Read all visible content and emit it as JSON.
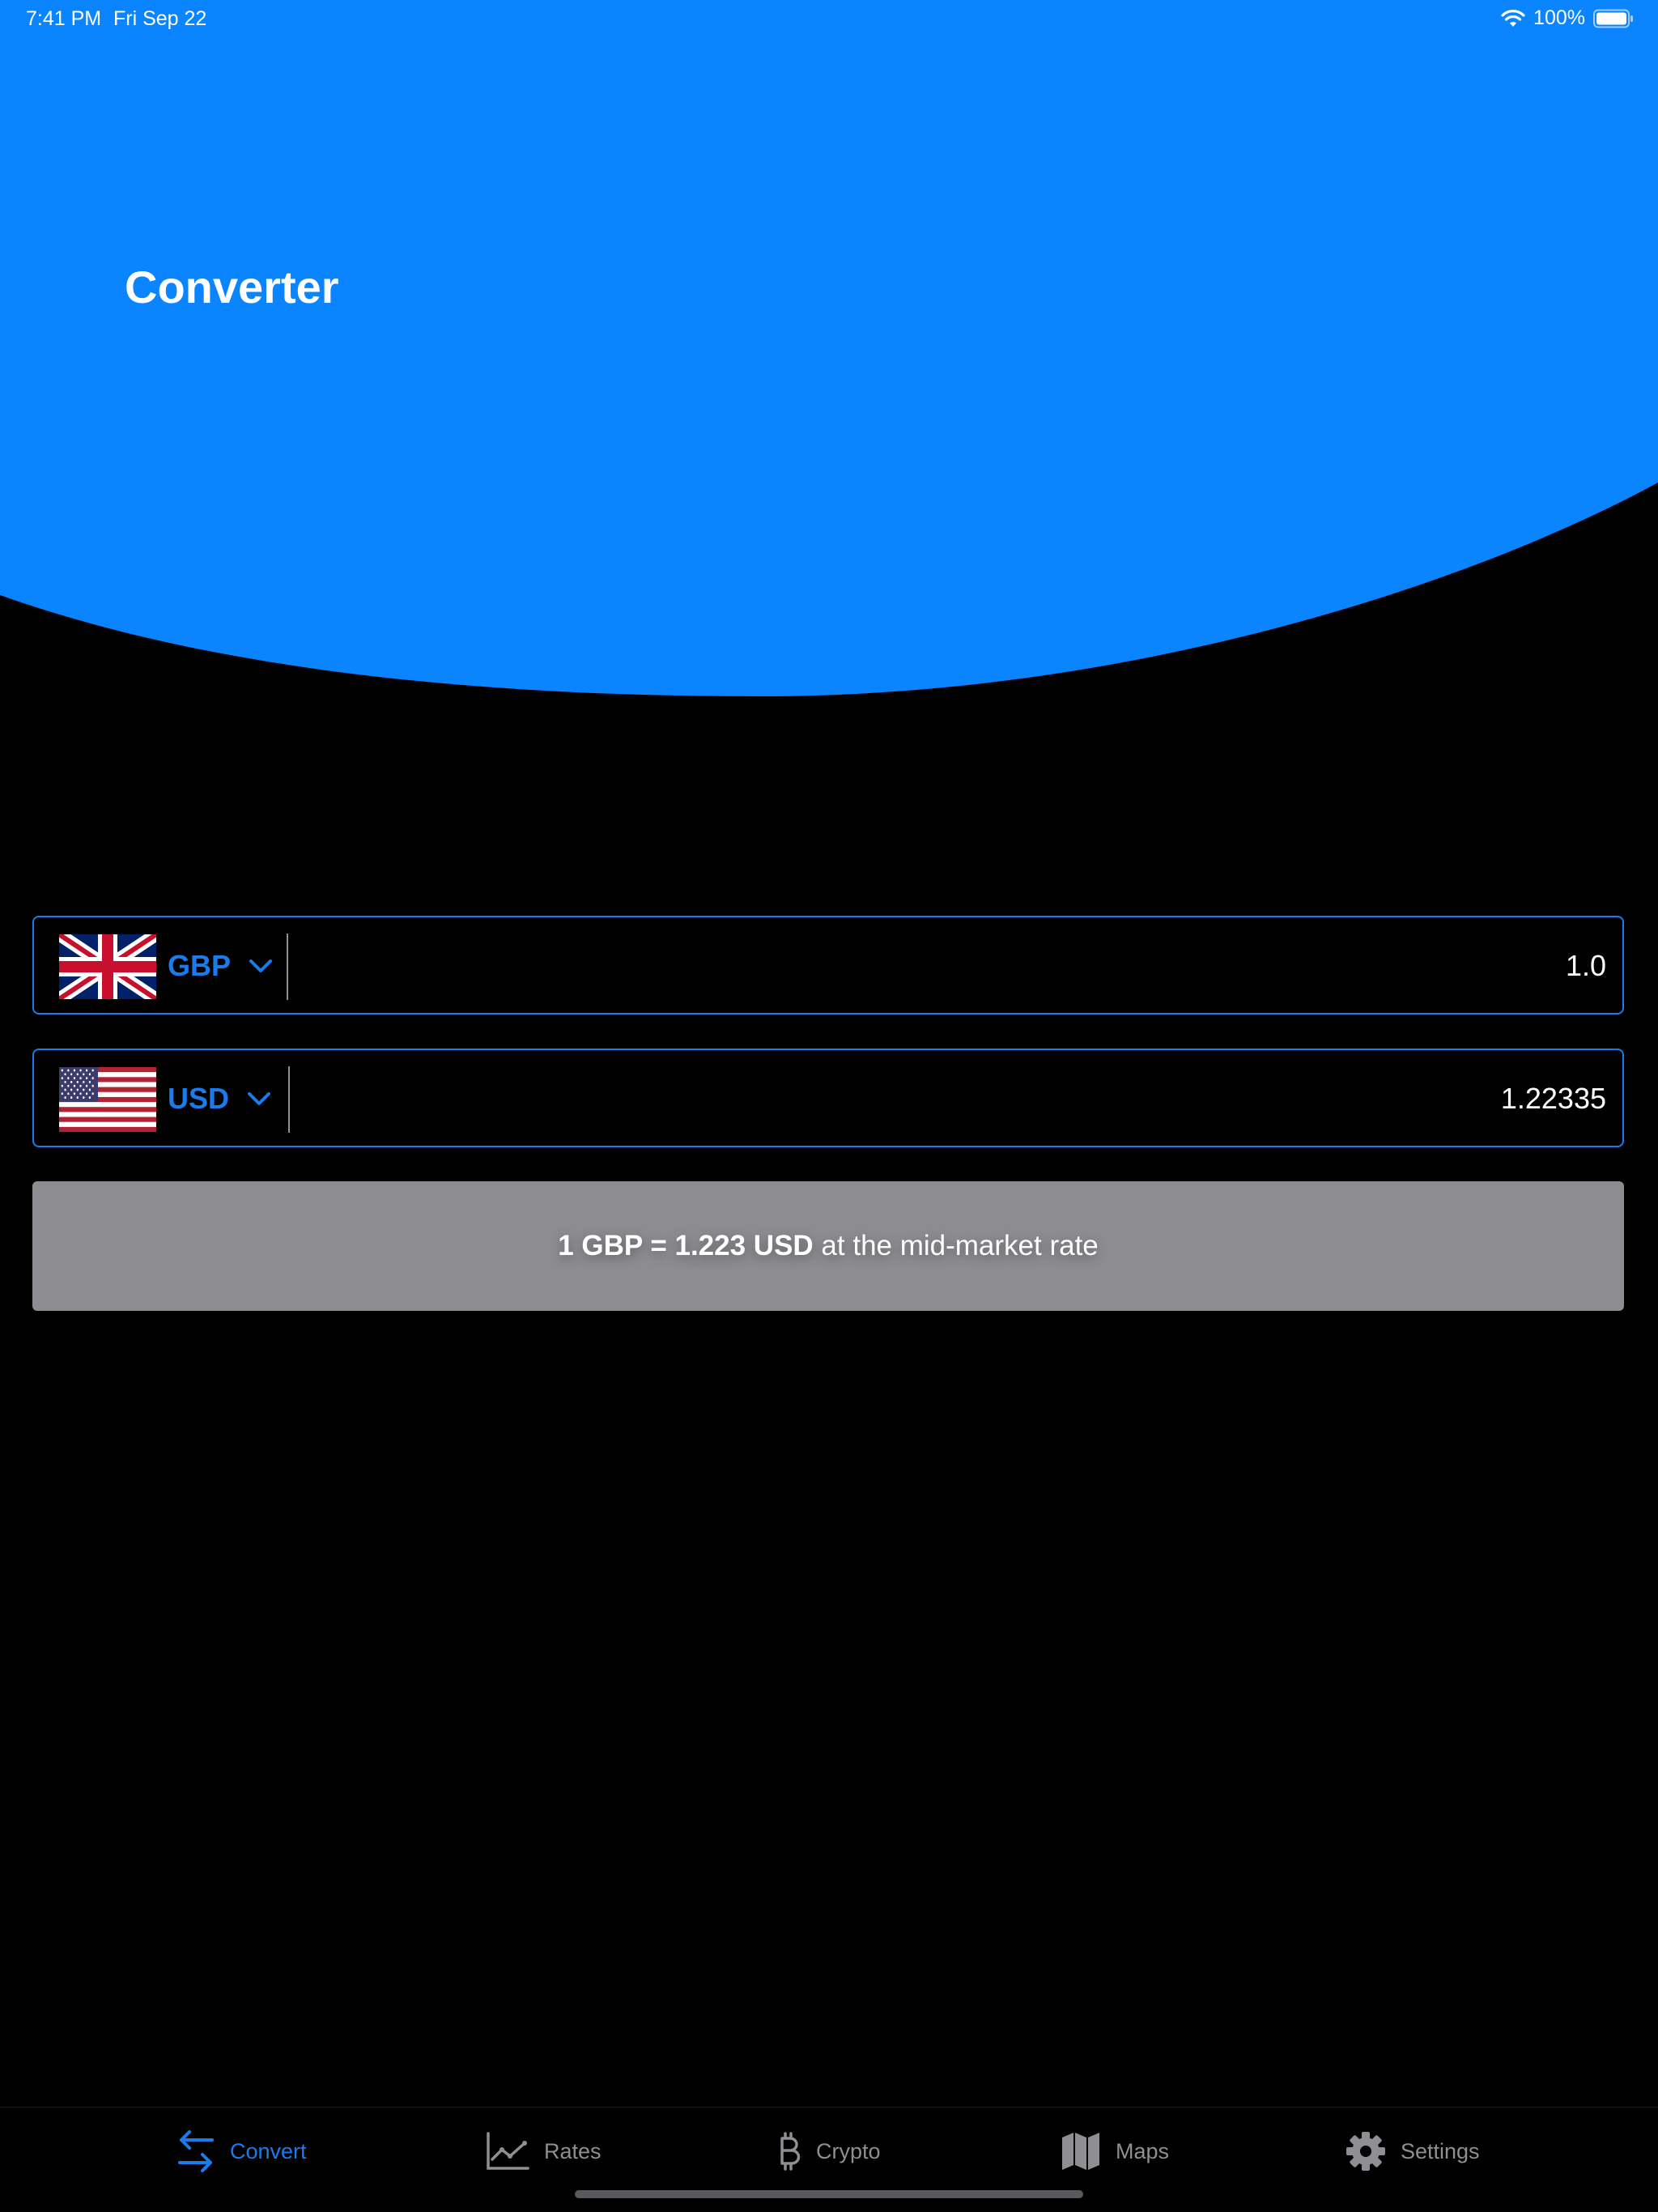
{
  "status_bar": {
    "time": "7:41 PM",
    "date": "Fri Sep 22",
    "battery_percent": "100%",
    "icons": [
      "wifi-icon",
      "battery-icon"
    ]
  },
  "header": {
    "title": "Converter",
    "color": "#0a84ff"
  },
  "converter": {
    "from": {
      "currency": "GBP",
      "flag": "uk-flag",
      "amount": "1.0"
    },
    "to": {
      "currency": "USD",
      "flag": "us-flag",
      "amount": "1.22335"
    },
    "rate": {
      "bold_part": "1 GBP = 1.223 USD",
      "rest": " at the mid-market rate"
    }
  },
  "tabs": [
    {
      "label": "Convert",
      "icon": "arrows-swap-icon",
      "active": true
    },
    {
      "label": "Rates",
      "icon": "line-chart-icon",
      "active": false
    },
    {
      "label": "Crypto",
      "icon": "bitcoin-icon",
      "active": false
    },
    {
      "label": "Maps",
      "icon": "map-icon",
      "active": false
    },
    {
      "label": "Settings",
      "icon": "gear-icon",
      "active": false
    }
  ],
  "colors": {
    "accent": "#1b7bea",
    "header_blue": "#0a84ff",
    "rate_box": "#8d8c91",
    "inactive_tab": "#8e8e93"
  }
}
